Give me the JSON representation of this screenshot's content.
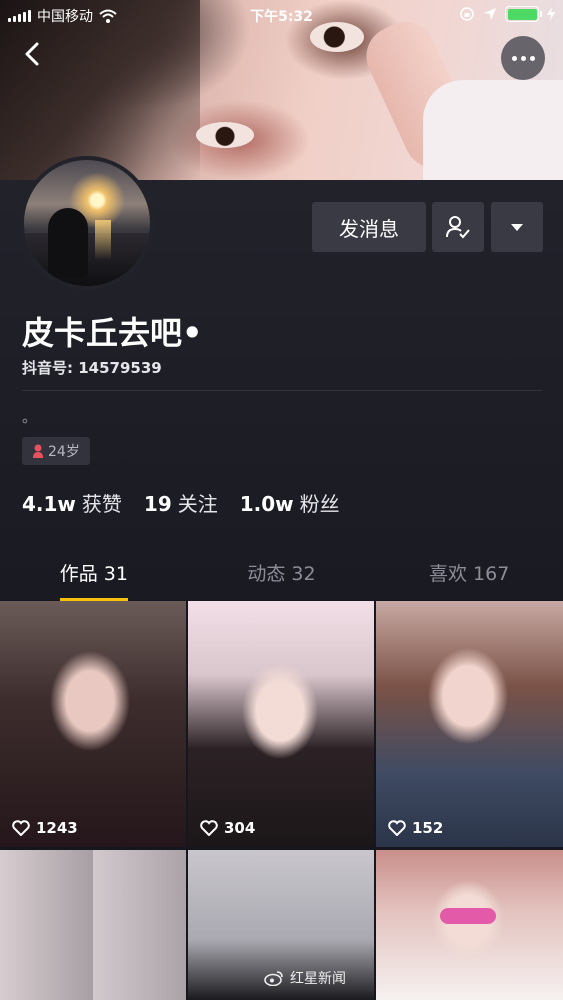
{
  "status_bar": {
    "carrier": "中国移动",
    "time": "下午5:32",
    "battery_percent": 100
  },
  "profile": {
    "nickname": "皮卡丘去吧•",
    "douyin_id": "抖音号: 14579539",
    "bio": "。",
    "age_badge": "24岁",
    "send_message_label": "发消息",
    "stats": [
      {
        "value": "4.1w",
        "label": "获赞"
      },
      {
        "value": "19",
        "label": "关注"
      },
      {
        "value": "1.0w",
        "label": "粉丝"
      }
    ]
  },
  "tabs": [
    {
      "label": "作品 31",
      "active": true
    },
    {
      "label": "动态 32",
      "active": false
    },
    {
      "label": "喜欢 167",
      "active": false
    }
  ],
  "videos": [
    {
      "likes": "1243"
    },
    {
      "likes": "304"
    },
    {
      "likes": "152"
    },
    {
      "likes": ""
    },
    {
      "likes": ""
    },
    {
      "likes": ""
    }
  ],
  "watermark": "红星新闻",
  "colors": {
    "tab_underline": "#f6c20b",
    "background": "#1a1a22",
    "button_bg": "#3a3a44",
    "battery": "#4cd964",
    "age_icon": "#e8525d"
  },
  "icons": [
    "back-icon",
    "more-icon",
    "follow-user-icon",
    "dropdown-icon",
    "female-icon",
    "heart-icon",
    "weibo-icon",
    "wifi-icon",
    "location-icon",
    "lock-rotation-icon",
    "charging-icon"
  ]
}
